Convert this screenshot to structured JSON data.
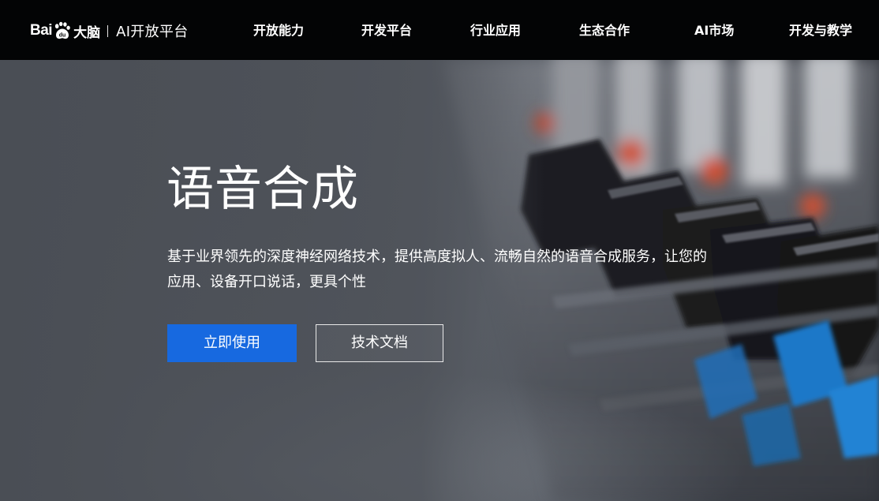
{
  "header": {
    "logo": {
      "bai_text": "Bai",
      "paw_icon": "baidu-paw-icon",
      "brain_text": "大脑",
      "platform_text": "AI开放平台"
    },
    "nav": [
      {
        "label": "开放能力"
      },
      {
        "label": "开发平台"
      },
      {
        "label": "行业应用"
      },
      {
        "label": "生态合作"
      },
      {
        "label": "AI市场"
      },
      {
        "label": "开发与教学"
      }
    ]
  },
  "hero": {
    "title": "语音合成",
    "description_line1": "基于业界领先的深度神经网络技术，提供高度拟人、流畅自然的语音合成服务，让您的",
    "description_line2": "应用、设备开口说话，更具个性",
    "primary_button": "立即使用",
    "secondary_button": "技术文档"
  },
  "colors": {
    "nav_background": "#030405",
    "primary_button": "#1769e0",
    "text": "#ffffff",
    "hero_base": "#4c5058",
    "fader_red": "#e8452a",
    "fader_blue": "#1f78c8"
  }
}
